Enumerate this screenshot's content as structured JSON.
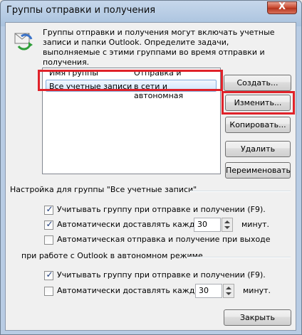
{
  "window": {
    "title": "Группы отправки и получения",
    "close_symbol": "X"
  },
  "description": "Группы отправки и получения могут включать учетные записи и папки Outlook. Определите задачи, выполняемые с этими группами во время отправки и получения.",
  "list": {
    "columns": [
      "Имя группы",
      "Отправка и получение"
    ],
    "rows": [
      {
        "name": "Все учетные записи",
        "mode": "в сети и автономная",
        "selected": true
      }
    ]
  },
  "buttons": {
    "create": "Создать...",
    "edit": "Изменить...",
    "copy": "Копировать...",
    "delete": "Удалить",
    "rename": "Переименовать",
    "close": "Закрыть"
  },
  "settings": {
    "header": "Настройка для группы \"Все учетные записи\"",
    "online": {
      "include_label": "Учитывать группу при отправке и получении (F9).",
      "include_checked": true,
      "schedule_label": "Автоматически доставлять каждые",
      "schedule_checked": true,
      "schedule_value": "30",
      "minutes_label": "минут.",
      "exit_label": "Автоматическая отправка и получение при выходе",
      "exit_checked": false
    },
    "offline_header": "при работе с Outlook в автономном режиме",
    "offline": {
      "include_label": "Учитывать группу при отправке и получении (F9).",
      "include_checked": true,
      "schedule_label": "Автоматически доставлять каждые",
      "schedule_checked": false,
      "schedule_value": "30",
      "minutes_label": "минут."
    }
  },
  "icons": {
    "send_receive": "send-receive-icon"
  },
  "colors": {
    "highlight_border": "#e0222a",
    "selection": "#cfe4fd"
  }
}
